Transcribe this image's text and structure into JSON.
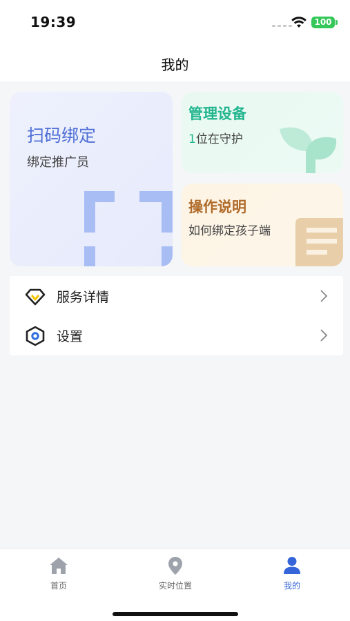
{
  "status_bar": {
    "time": "19:39",
    "battery": "100"
  },
  "nav": {
    "title": "我的"
  },
  "cards": {
    "scan": {
      "title": "扫码绑定",
      "subtitle": "绑定推广员",
      "icon": "scan-frame-icon"
    },
    "device": {
      "title": "管理设备",
      "count": "1",
      "subtitle_rest": "位在守护",
      "icon": "leaf-icon"
    },
    "guide": {
      "title": "操作说明",
      "subtitle": "如何绑定孩子端",
      "icon": "document-icon"
    }
  },
  "menu": {
    "items": [
      {
        "label": "服务详情",
        "icon": "diamond-icon"
      },
      {
        "label": "设置",
        "icon": "hexagon-settings-icon"
      }
    ]
  },
  "tabs": [
    {
      "label": "首页",
      "icon": "home-icon"
    },
    {
      "label": "实时位置",
      "icon": "location-pin-icon"
    },
    {
      "label": "我的",
      "icon": "user-icon",
      "active": true
    }
  ],
  "colors": {
    "scan_accent": "#4f6fd6",
    "device_accent": "#21b58e",
    "guide_accent": "#b06b2a",
    "tab_active": "#3565d8"
  }
}
